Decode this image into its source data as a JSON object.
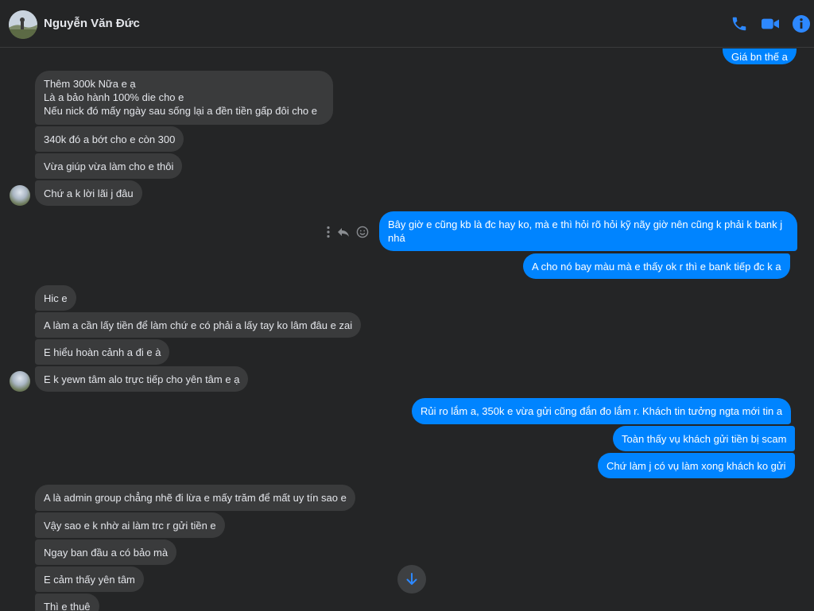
{
  "header": {
    "contact_name": "Nguyễn Văn Đức",
    "actions": [
      "phone-icon",
      "video-icon",
      "info-icon"
    ]
  },
  "accent_color": "#0084ff",
  "messages": {
    "m0": "Giá bn thế a",
    "m1": [
      "Thêm 300k Nữa e ạ",
      "Là a bảo hành 100% die cho e",
      "Nếu nick đó mấy ngày sau sống lại a đền tiền gấp đôi cho e"
    ],
    "m2": "340k đó a bớt cho e còn 300",
    "m3": "Vừa giúp vừa làm cho e thôi",
    "m4": "Chứ a k lời lãi j đâu",
    "m5": "Bây giờ e cũng kb là đc hay ko, mà e thì hỏi rõ hỏi kỹ nãy giờ nên cũng k phải k bank j nhá",
    "m6": "A cho nó bay màu mà e thấy ok r thì e bank tiếp đc k a",
    "m7": "Hic e",
    "m8": "A làm a cần lấy tiền để làm chứ e có phải a lấy tay ko lâm đâu e zai",
    "m9": "E hiểu hoàn cảnh a đi e à",
    "m10": "E k yewn tâm alo trực tiếp cho yên tâm e ạ",
    "m11": "Rủi ro lắm a, 350k e vừa gửi cũng đắn đo lắm r. Khách tin tưởng ngta mới tin a",
    "m12": "Toàn thấy vụ khách gửi tiền bị scam",
    "m13": "Chứ làm j có vụ làm xong khách ko gửi",
    "m14": "A là admin group chẳng nhẽ đi lừa e mấy trăm để mất uy tín sao e",
    "m15": "Vậy sao e k nhờ ai làm trc r gửi tiền e",
    "m16": "Ngay ban đầu a có bảo mà",
    "m17": "E cảm thấy yên tâm",
    "m18": "Thì e thuê"
  },
  "hover_icons": [
    "more-icon",
    "reply-icon",
    "react-icon"
  ],
  "scroll_icon": "arrow-down-icon"
}
